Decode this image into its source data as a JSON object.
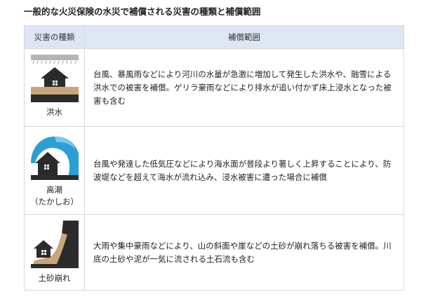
{
  "page_title": "一般的な火災保険の水災で補償される災害の種類と補償範囲",
  "table": {
    "headers": [
      "災害の種類",
      "補償範囲"
    ],
    "rows": [
      {
        "icon": "flood-icon",
        "type_line1": "洪水",
        "type_line2": "",
        "description": "台風、暴風雨などにより河川の水量が急激に増加して発生した洪水や、融雪による洪水での被害を補償。ゲリラ豪雨などにより排水が追い付かず床上浸水となった被害も含む"
      },
      {
        "icon": "tsunami-wave-icon",
        "type_line1": "高潮",
        "type_line2": "（たかしお）",
        "description": "台風や発達した低気圧などにより海水面が普段より著しく上昇することにより、防波堤などを超えて海水が流れ込み、浸水被害に遭った場合に補償"
      },
      {
        "icon": "landslide-icon",
        "type_line1": "土砂崩れ",
        "type_line2": "",
        "description": "大雨や集中豪雨などにより、山の斜面や崖などの土砂が崩れ落ちる被害を補償。川底の土砂や泥が一気に流される土石流も含む"
      }
    ]
  },
  "colors": {
    "header_bg": "#dde6f2",
    "border": "#d6d9de",
    "icon_dark": "#2b2b2b",
    "icon_sand": "#c9a67a",
    "icon_wave": "#2a9fd6",
    "icon_rain": "#b5b5b5"
  }
}
